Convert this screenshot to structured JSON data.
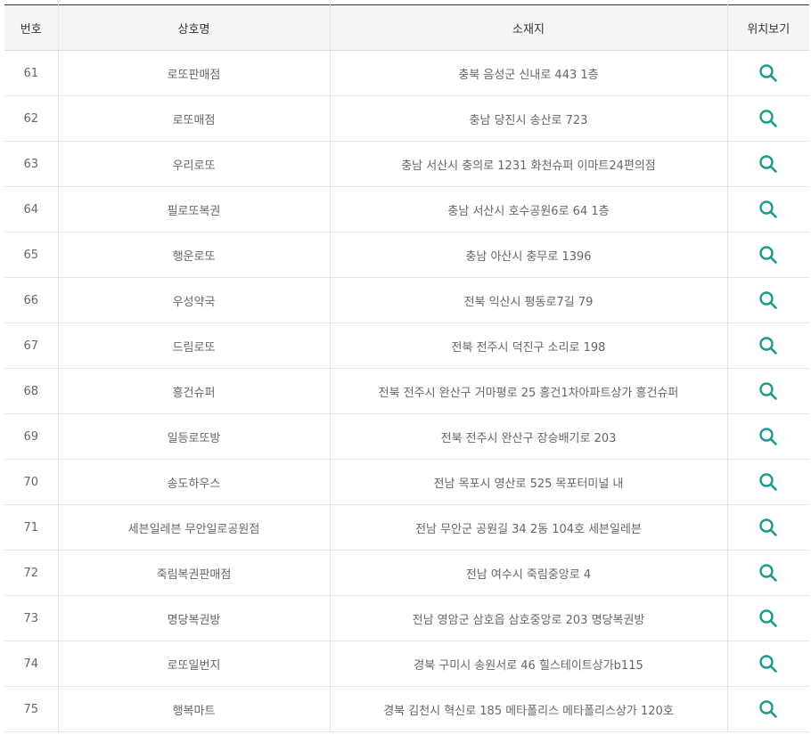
{
  "table": {
    "headers": {
      "number": "번호",
      "store_name": "상호명",
      "address": "소재지",
      "map": "위치보기"
    },
    "rows": [
      {
        "number": "61",
        "name": "로또판매점",
        "address": "충북 음성군 신내로 443 1층"
      },
      {
        "number": "62",
        "name": "로또매점",
        "address": "충남 당진시 송산로 723"
      },
      {
        "number": "63",
        "name": "우리로또",
        "address": "충남 서산시 충의로 1231 화천슈퍼 이마트24편의점"
      },
      {
        "number": "64",
        "name": "필로또복권",
        "address": "충남 서산시 호수공원6로 64 1층"
      },
      {
        "number": "65",
        "name": "행운로또",
        "address": "충남 아산시 충무로 1396"
      },
      {
        "number": "66",
        "name": "우성약국",
        "address": "전북 익산시 평동로7길 79"
      },
      {
        "number": "67",
        "name": "드림로또",
        "address": "전북 전주시 덕진구 소리로 198"
      },
      {
        "number": "68",
        "name": "흥건슈퍼",
        "address": "전북 전주시 완산구 거마평로 25 흥건1차아파트상가 흥건슈퍼"
      },
      {
        "number": "69",
        "name": "일등로또방",
        "address": "전북 전주시 완산구 장승배기로 203"
      },
      {
        "number": "70",
        "name": "송도하우스",
        "address": "전남 목포시 영산로 525 목포터미널 내"
      },
      {
        "number": "71",
        "name": "세븐일레븐 무안일로공원점",
        "address": "전남 무안군 공원길 34 2동 104호 세븐일레븐"
      },
      {
        "number": "72",
        "name": "죽림복권판매점",
        "address": "전남 여수시 죽림중앙로 4"
      },
      {
        "number": "73",
        "name": "명당복권방",
        "address": "전남 영암군 삼호읍 삼호중앙로 203 명당복권방"
      },
      {
        "number": "74",
        "name": "로또일번지",
        "address": "경북 구미시 송원서로 46 힐스테이트상가b115"
      },
      {
        "number": "75",
        "name": "행복마트",
        "address": "경북 김천시 혁신로 185 메타폴리스 메타폴리스상가 120호"
      }
    ]
  },
  "icons": {
    "map": "search-icon"
  },
  "colors": {
    "header_bg": "#f5f5f5",
    "top_border": "#333333",
    "row_border": "#e6e6e6",
    "text": "#666666",
    "header_text": "#333333",
    "accent": "#1a9b8c"
  }
}
